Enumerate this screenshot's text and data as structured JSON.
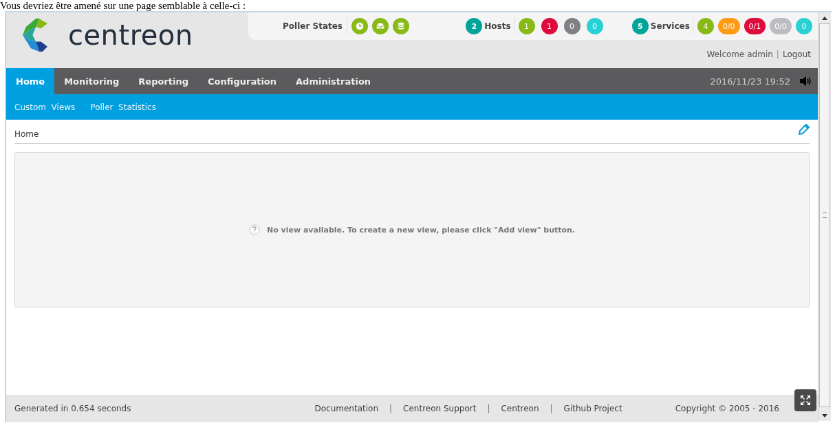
{
  "caption": "Vous devriez être amené sur une page semblable à celle-ci :",
  "header": {
    "logo_text": "centreon",
    "poller_states": {
      "label": "Poller States",
      "icons": [
        {
          "kind": "clock",
          "color": "#88b917"
        },
        {
          "kind": "inbox",
          "color": "#88b917"
        },
        {
          "kind": "database",
          "color": "#88b917"
        }
      ]
    },
    "hosts": {
      "count": "2",
      "label": "Hosts",
      "badges": [
        {
          "text": "1",
          "color": "#88b917"
        },
        {
          "text": "1",
          "color": "#e00b3d"
        },
        {
          "text": "0",
          "color": "#818185"
        },
        {
          "text": "0",
          "color": "#2ad1d4"
        }
      ]
    },
    "services": {
      "count": "5",
      "label": "Services",
      "badges": [
        {
          "text": "4",
          "color": "#88b917"
        },
        {
          "text": "0/0",
          "color": "#ff9a13"
        },
        {
          "text": "0/1",
          "color": "#e00b3d"
        },
        {
          "text": "0/0",
          "color": "#bcbdc0"
        },
        {
          "text": "0",
          "color": "#2ad1d4"
        }
      ]
    },
    "user": [
      {
        "kind": "text",
        "text": "Welcome admin"
      },
      {
        "kind": "separator",
        "text": "|"
      },
      {
        "kind": "link",
        "text": "Logout"
      }
    ]
  },
  "nav": {
    "items": [
      {
        "label": "Home",
        "selected": true
      },
      {
        "label": "Monitoring",
        "selected": false
      },
      {
        "label": "Reporting",
        "selected": false
      },
      {
        "label": "Configuration",
        "selected": false
      },
      {
        "label": "Administration",
        "selected": false
      }
    ],
    "datetime": "2016/11/23 19:52"
  },
  "subnav": [
    "Custom  Views",
    "Poller  Statistics"
  ],
  "breadcrumb": "Home",
  "message": "No view available. To create a new view, please click \"Add view\" button.",
  "footer": {
    "generated": "Generated in 0.654 seconds",
    "links": [
      {
        "kind": "link",
        "text": "Documentation"
      },
      {
        "kind": "separator",
        "text": "|"
      },
      {
        "kind": "link",
        "text": "Centreon Support"
      },
      {
        "kind": "separator",
        "text": "|"
      },
      {
        "kind": "link",
        "text": "Centreon"
      },
      {
        "kind": "separator",
        "text": "|"
      },
      {
        "kind": "link",
        "text": "Github Project"
      }
    ],
    "copyright": "Copyright © 2005 - 2016"
  }
}
